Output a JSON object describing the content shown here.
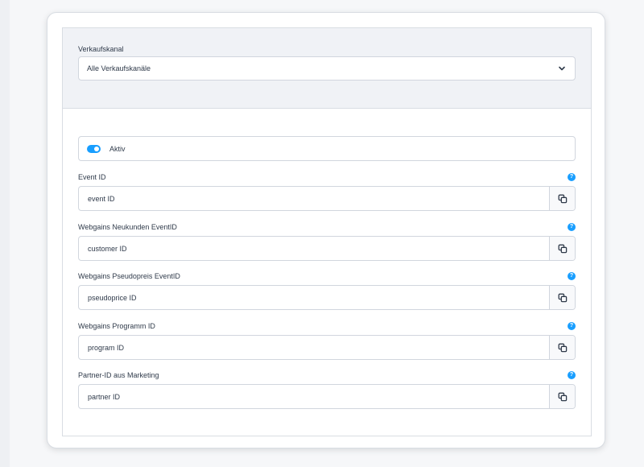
{
  "sales_channel": {
    "label": "Verkaufskanal",
    "selected": "Alle Verkaufskanäle"
  },
  "active_toggle": {
    "label": "Aktiv",
    "enabled": true
  },
  "fields": [
    {
      "label": "Event ID",
      "placeholder": "event ID",
      "help": "?"
    },
    {
      "label": "Webgains Neukunden EventID",
      "placeholder": "customer ID",
      "help": "?"
    },
    {
      "label": "Webgains Pseudopreis EventID",
      "placeholder": "pseudoprice ID",
      "help": "?"
    },
    {
      "label": "Webgains Programm ID",
      "placeholder": "program ID",
      "help": "?"
    },
    {
      "label": "Partner-ID aus Marketing",
      "placeholder": "partner ID",
      "help": "?"
    }
  ],
  "colors": {
    "accent": "#189eff",
    "section_bg": "#f0f2f6",
    "border": "#d1d6de",
    "text": "#2f3a4a"
  },
  "icons": {
    "dropdown": "chevron-down-icon",
    "copy": "copy-icon",
    "help": "help-icon"
  }
}
